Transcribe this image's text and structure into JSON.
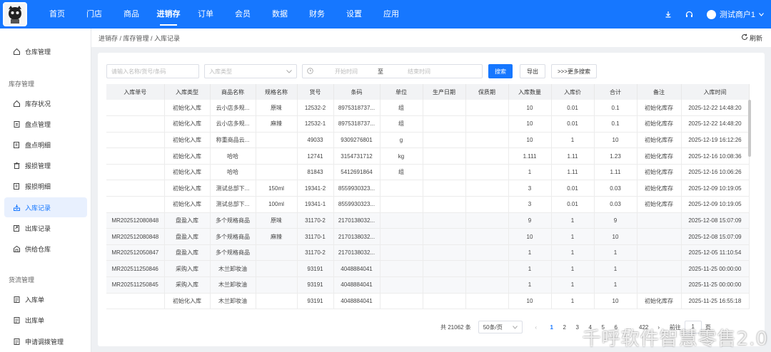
{
  "header": {
    "nav": [
      "首页",
      "门店",
      "商品",
      "进销存",
      "订单",
      "会员",
      "数据",
      "财务",
      "设置",
      "应用"
    ],
    "active_nav": "进销存",
    "user_name": "测试商户1"
  },
  "sidebar": {
    "top_item": "仓库管理",
    "group1": "库存管理",
    "group1_items": [
      "库存状况",
      "盘点管理",
      "盘点明细",
      "报损管理",
      "报损明细",
      "入库记录",
      "出库记录",
      "供给仓库"
    ],
    "group2": "货流管理",
    "group2_items": [
      "入库单",
      "出库单",
      "申请调拨管理"
    ]
  },
  "breadcrumb": "进销存 / 库存管理 / 入库记录",
  "refresh_label": "刷新",
  "filters": {
    "search_placeholder": "请输入名称/货号/条码",
    "type_placeholder": "入库类型",
    "start_placeholder": "开始时间",
    "range_sep": "至",
    "end_placeholder": "结束时间",
    "search_button": "搜索",
    "export_button": "导出",
    "more_button": ">>>更多搜索"
  },
  "table": {
    "columns": [
      "入库单号",
      "入库类型",
      "商品名称",
      "规格名称",
      "货号",
      "条码",
      "单位",
      "生产日期",
      "保质期",
      "入库数量",
      "入库价",
      "合计",
      "备注",
      "入库时间"
    ],
    "rows": [
      [
        "",
        "初始化入库",
        "云小店多规...",
        "原味",
        "12532-2",
        "8975318737...",
        "组",
        "",
        "",
        "10",
        "0.01",
        "0.1",
        "初始化库存",
        "2025-12-22 14:48:20"
      ],
      [
        "",
        "初始化入库",
        "云小店多规...",
        "麻辣",
        "12532-1",
        "8975318737...",
        "组",
        "",
        "",
        "10",
        "0.01",
        "0.1",
        "初始化库存",
        "2025-12-22 14:48:20"
      ],
      [
        "",
        "初始化入库",
        "称重商品云...",
        "",
        "49033",
        "9309276801",
        "g",
        "",
        "",
        "10",
        "1",
        "10",
        "初始化库存",
        "2025-12-19 16:12:26"
      ],
      [
        "",
        "初始化入库",
        "哈哈",
        "",
        "12741",
        "3154731712",
        "kg",
        "",
        "",
        "1.111",
        "1.11",
        "1.23",
        "初始化库存",
        "2025-12-16 10:08:36"
      ],
      [
        "",
        "初始化入库",
        "哈哈",
        "",
        "81843",
        "5412691864",
        "组",
        "",
        "",
        "1",
        "1.11",
        "1.11",
        "初始化库存",
        "2025-12-16 10:06:26"
      ],
      [
        "",
        "初始化入库",
        "测试总部下...",
        "150ml",
        "19341-2",
        "8559930323...",
        "",
        "",
        "",
        "3",
        "0.01",
        "0.03",
        "初始化库存",
        "2025-12-09 10:19:05"
      ],
      [
        "",
        "初始化入库",
        "测试总部下...",
        "100ml",
        "19341-1",
        "8559930323...",
        "",
        "",
        "",
        "3",
        "0.01",
        "0.03",
        "初始化库存",
        "2025-12-09 10:19:05"
      ],
      [
        "MR202512080848",
        "盘盈入库",
        "多个规格商品",
        "原味",
        "31170-2",
        "2170138032...",
        "",
        "",
        "",
        "9",
        "1",
        "9",
        "",
        "2025-12-08 15:07:09"
      ],
      [
        "MR202512080848",
        "盘盈入库",
        "多个规格商品",
        "麻辣",
        "31170-1",
        "2170138032...",
        "",
        "",
        "",
        "10",
        "1",
        "10",
        "",
        "2025-12-08 15:07:09"
      ],
      [
        "MR202512050847",
        "盘盈入库",
        "多个规格商品",
        "",
        "31170-2",
        "2170138032...",
        "",
        "",
        "",
        "1",
        "1",
        "1",
        "",
        "2025-12-05 11:10:54"
      ],
      [
        "MR202511250846",
        "采购入库",
        "木兰卸妆油",
        "",
        "93191",
        "4048884041",
        "",
        "",
        "",
        "1",
        "1",
        "1",
        "",
        "2025-11-25 00:00:00"
      ],
      [
        "MR202511250845",
        "采购入库",
        "木兰卸妆油",
        "",
        "93191",
        "4048884041",
        "",
        "",
        "",
        "1",
        "1",
        "1",
        "",
        "2025-11-25 00:00:00"
      ],
      [
        "",
        "初始化入库",
        "木兰卸妆油",
        "",
        "93191",
        "4048884041",
        "",
        "",
        "",
        "10",
        "1",
        "10",
        "初始化库存",
        "2025-11-25 16:55:18"
      ]
    ]
  },
  "pagination": {
    "total": "共 21062 条",
    "page_size": "50条/页",
    "pages": [
      "1",
      "2",
      "3",
      "4",
      "5",
      "6",
      "...",
      "422"
    ],
    "current": "1",
    "goto_label": "前往",
    "goto_value": "1",
    "page_suffix": "页"
  },
  "watermark": "千呼软件智慧零售2.0"
}
